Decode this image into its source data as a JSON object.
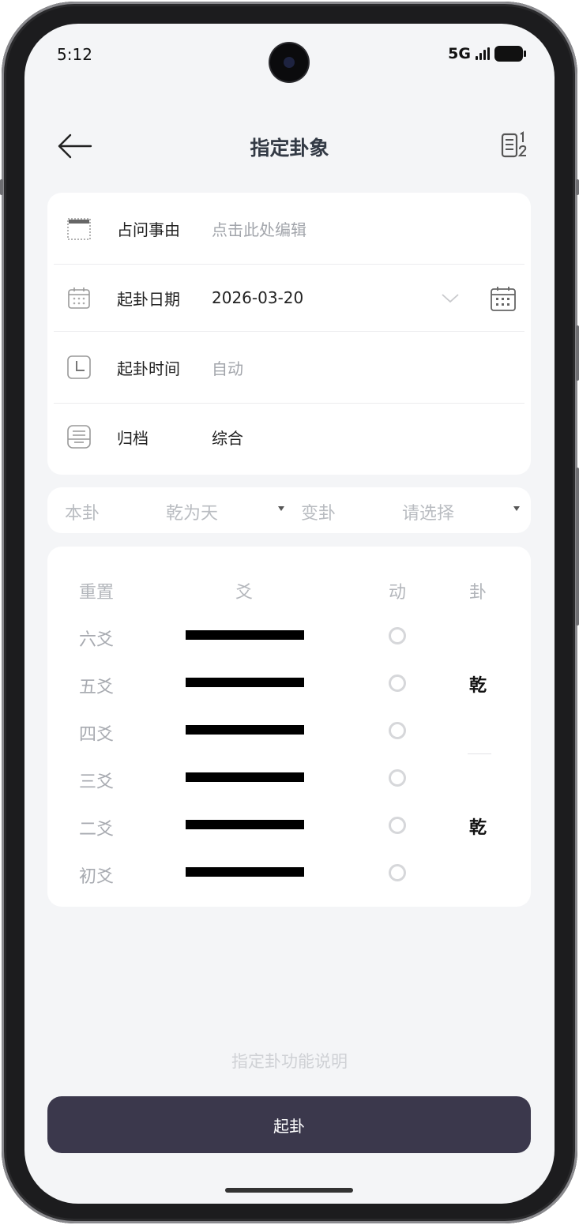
{
  "status": {
    "time": "5:12",
    "network": "5G"
  },
  "nav": {
    "title": "指定卦象"
  },
  "form": {
    "reason": {
      "label": "占问事由",
      "placeholder": "点击此处编辑"
    },
    "date": {
      "label": "起卦日期",
      "value": "2026-03-20"
    },
    "time": {
      "label": "起卦时间",
      "value": "自动"
    },
    "archive": {
      "label": "归档",
      "value": "综合"
    }
  },
  "selector": {
    "ben_label": "本卦",
    "ben_value": "乾为天",
    "bian_label": "变卦",
    "bian_value": "请选择"
  },
  "table": {
    "headers": {
      "reset": "重置",
      "yao": "爻",
      "moving": "动",
      "gua": "卦"
    },
    "rows": [
      {
        "name": "六爻",
        "line": "yang",
        "moving": false
      },
      {
        "name": "五爻",
        "line": "yang",
        "moving": false
      },
      {
        "name": "四爻",
        "line": "yang",
        "moving": false
      },
      {
        "name": "三爻",
        "line": "yang",
        "moving": false
      },
      {
        "name": "二爻",
        "line": "yang",
        "moving": false
      },
      {
        "name": "初爻",
        "line": "yang",
        "moving": false
      }
    ],
    "upper_trigram": "乾",
    "lower_trigram": "乾"
  },
  "footer": {
    "help_link": "指定卦功能说明",
    "submit_label": "起卦"
  },
  "colors": {
    "primary_button": "#3b384c",
    "background": "#f4f5f7"
  }
}
